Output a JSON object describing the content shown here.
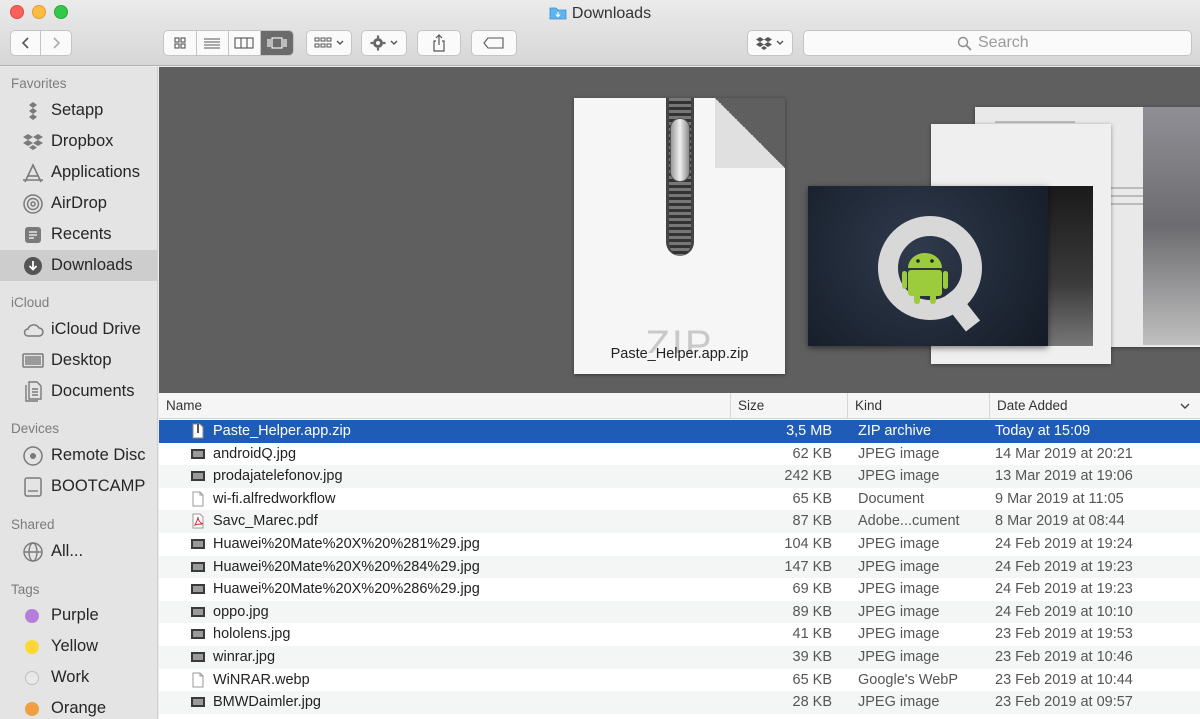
{
  "window": {
    "title": "Downloads"
  },
  "toolbar": {
    "view_modes": [
      "icon-view",
      "list-view",
      "column-view",
      "gallery-view"
    ],
    "active_view": "gallery-view",
    "search_placeholder": "Search"
  },
  "sidebar": {
    "sections": [
      {
        "heading": "Favorites",
        "items": [
          {
            "label": "Setapp",
            "icon": "setapp-icon"
          },
          {
            "label": "Dropbox",
            "icon": "dropbox-icon"
          },
          {
            "label": "Applications",
            "icon": "applications-icon"
          },
          {
            "label": "AirDrop",
            "icon": "airdrop-icon"
          },
          {
            "label": "Recents",
            "icon": "recents-icon"
          },
          {
            "label": "Downloads",
            "icon": "downloads-icon",
            "selected": true
          }
        ]
      },
      {
        "heading": "iCloud",
        "items": [
          {
            "label": "iCloud Drive",
            "icon": "cloud-icon"
          },
          {
            "label": "Desktop",
            "icon": "desktop-icon"
          },
          {
            "label": "Documents",
            "icon": "documents-icon"
          }
        ]
      },
      {
        "heading": "Devices",
        "items": [
          {
            "label": "Remote Disc",
            "icon": "disc-icon"
          },
          {
            "label": "BOOTCAMP",
            "icon": "drive-icon"
          }
        ]
      },
      {
        "heading": "Shared",
        "items": [
          {
            "label": "All...",
            "icon": "network-icon"
          }
        ]
      },
      {
        "heading": "Tags",
        "items": [
          {
            "label": "Purple",
            "color": "#b57edc"
          },
          {
            "label": "Yellow",
            "color": "#fdd835"
          },
          {
            "label": "Work",
            "color": "#e0e0e0"
          },
          {
            "label": "Orange",
            "color": "#f0a040"
          }
        ]
      }
    ]
  },
  "preview": {
    "filename": "Paste_Helper.app.zip",
    "doc_text": "ZIP",
    "thumb_letter": "Q"
  },
  "list": {
    "columns": {
      "name": "Name",
      "size": "Size",
      "kind": "Kind",
      "date": "Date Added"
    },
    "rows": [
      {
        "name": "Paste_Helper.app.zip",
        "size": "3,5 MB",
        "kind": "ZIP archive",
        "date": "Today at 15:09",
        "icon": "zip-file-icon",
        "selected": true
      },
      {
        "name": "androidQ.jpg",
        "size": "62 KB",
        "kind": "JPEG image",
        "date": "14 Mar 2019 at 20:21",
        "icon": "image-thumb-icon"
      },
      {
        "name": "prodajatelefonov.jpg",
        "size": "242 KB",
        "kind": "JPEG image",
        "date": "13 Mar 2019 at 19:06",
        "icon": "image-thumb-icon"
      },
      {
        "name": "wi-fi.alfredworkflow",
        "size": "65 KB",
        "kind": "Document",
        "date": "9 Mar 2019 at 11:05",
        "icon": "document-icon"
      },
      {
        "name": "Savc_Marec.pdf",
        "size": "87 KB",
        "kind": "Adobe...cument",
        "date": "8 Mar 2019 at 08:44",
        "icon": "pdf-icon"
      },
      {
        "name": "Huawei%20Mate%20X%20%281%29.jpg",
        "size": "104 KB",
        "kind": "JPEG image",
        "date": "24 Feb 2019 at 19:24",
        "icon": "image-thumb-icon"
      },
      {
        "name": "Huawei%20Mate%20X%20%284%29.jpg",
        "size": "147 KB",
        "kind": "JPEG image",
        "date": "24 Feb 2019 at 19:23",
        "icon": "image-thumb-icon"
      },
      {
        "name": "Huawei%20Mate%20X%20%286%29.jpg",
        "size": "69 KB",
        "kind": "JPEG image",
        "date": "24 Feb 2019 at 19:23",
        "icon": "image-thumb-icon"
      },
      {
        "name": "oppo.jpg",
        "size": "89 KB",
        "kind": "JPEG image",
        "date": "24 Feb 2019 at 10:10",
        "icon": "image-thumb-icon"
      },
      {
        "name": "hololens.jpg",
        "size": "41 KB",
        "kind": "JPEG image",
        "date": "23 Feb 2019 at 19:53",
        "icon": "image-thumb-icon"
      },
      {
        "name": "winrar.jpg",
        "size": "39 KB",
        "kind": "JPEG image",
        "date": "23 Feb 2019 at 10:46",
        "icon": "image-thumb-icon"
      },
      {
        "name": "WiNRAR.webp",
        "size": "65 KB",
        "kind": "Google's WebP",
        "date": "23 Feb 2019 at 10:44",
        "icon": "document-icon"
      },
      {
        "name": "BMWDaimler.jpg",
        "size": "28 KB",
        "kind": "JPEG image",
        "date": "23 Feb 2019 at 09:57",
        "icon": "image-thumb-icon"
      }
    ]
  }
}
